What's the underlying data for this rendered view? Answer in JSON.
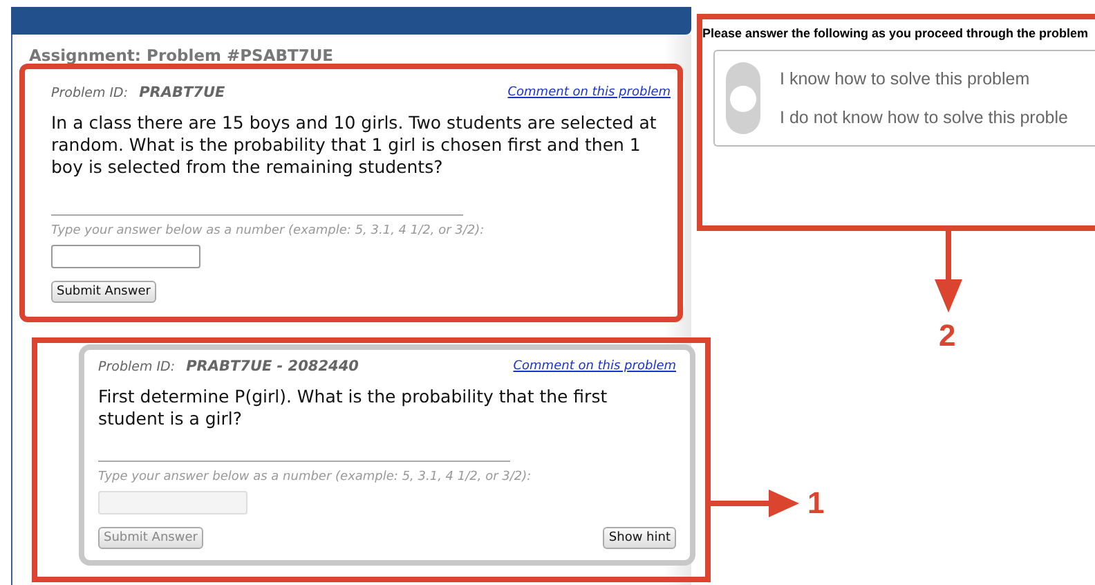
{
  "assignment_title": "Assignment: Problem #PSABT7UE",
  "problems": [
    {
      "kind": "main",
      "id_label": "Problem ID:",
      "id": "PRABT7UE",
      "comment_link": "Comment on this problem",
      "question": "In a class there are 15 boys and 10 girls. Two students are selected at random. What is the probability that 1 girl is chosen first and then 1 boy is selected from the remaining students?",
      "answer_prompt": "Type your answer below as a number (example: 5, 3.1, 4 1/2, or 3/2):",
      "submit": "Submit Answer",
      "disabled": false
    },
    {
      "kind": "scaffold",
      "id_label": "Problem ID:",
      "id": "PRABT7UE - 2082440",
      "comment_link": "Comment on this problem",
      "question": "First determine P(girl). What is the probability that the first student is a girl?",
      "answer_prompt": "Type your answer below as a number (example: 5, 3.1, 4 1/2, or 3/2):",
      "submit": "Submit Answer",
      "hint": "Show hint",
      "disabled": true
    }
  ],
  "survey": {
    "prompt": "Please answer the following as you proceed through the problem",
    "options": [
      {
        "label": "I know how to solve this problem",
        "selected": false
      },
      {
        "label": "I do not know how to solve this proble",
        "selected": false
      }
    ]
  },
  "callouts": [
    {
      "label": "1"
    },
    {
      "label": "2"
    }
  ]
}
